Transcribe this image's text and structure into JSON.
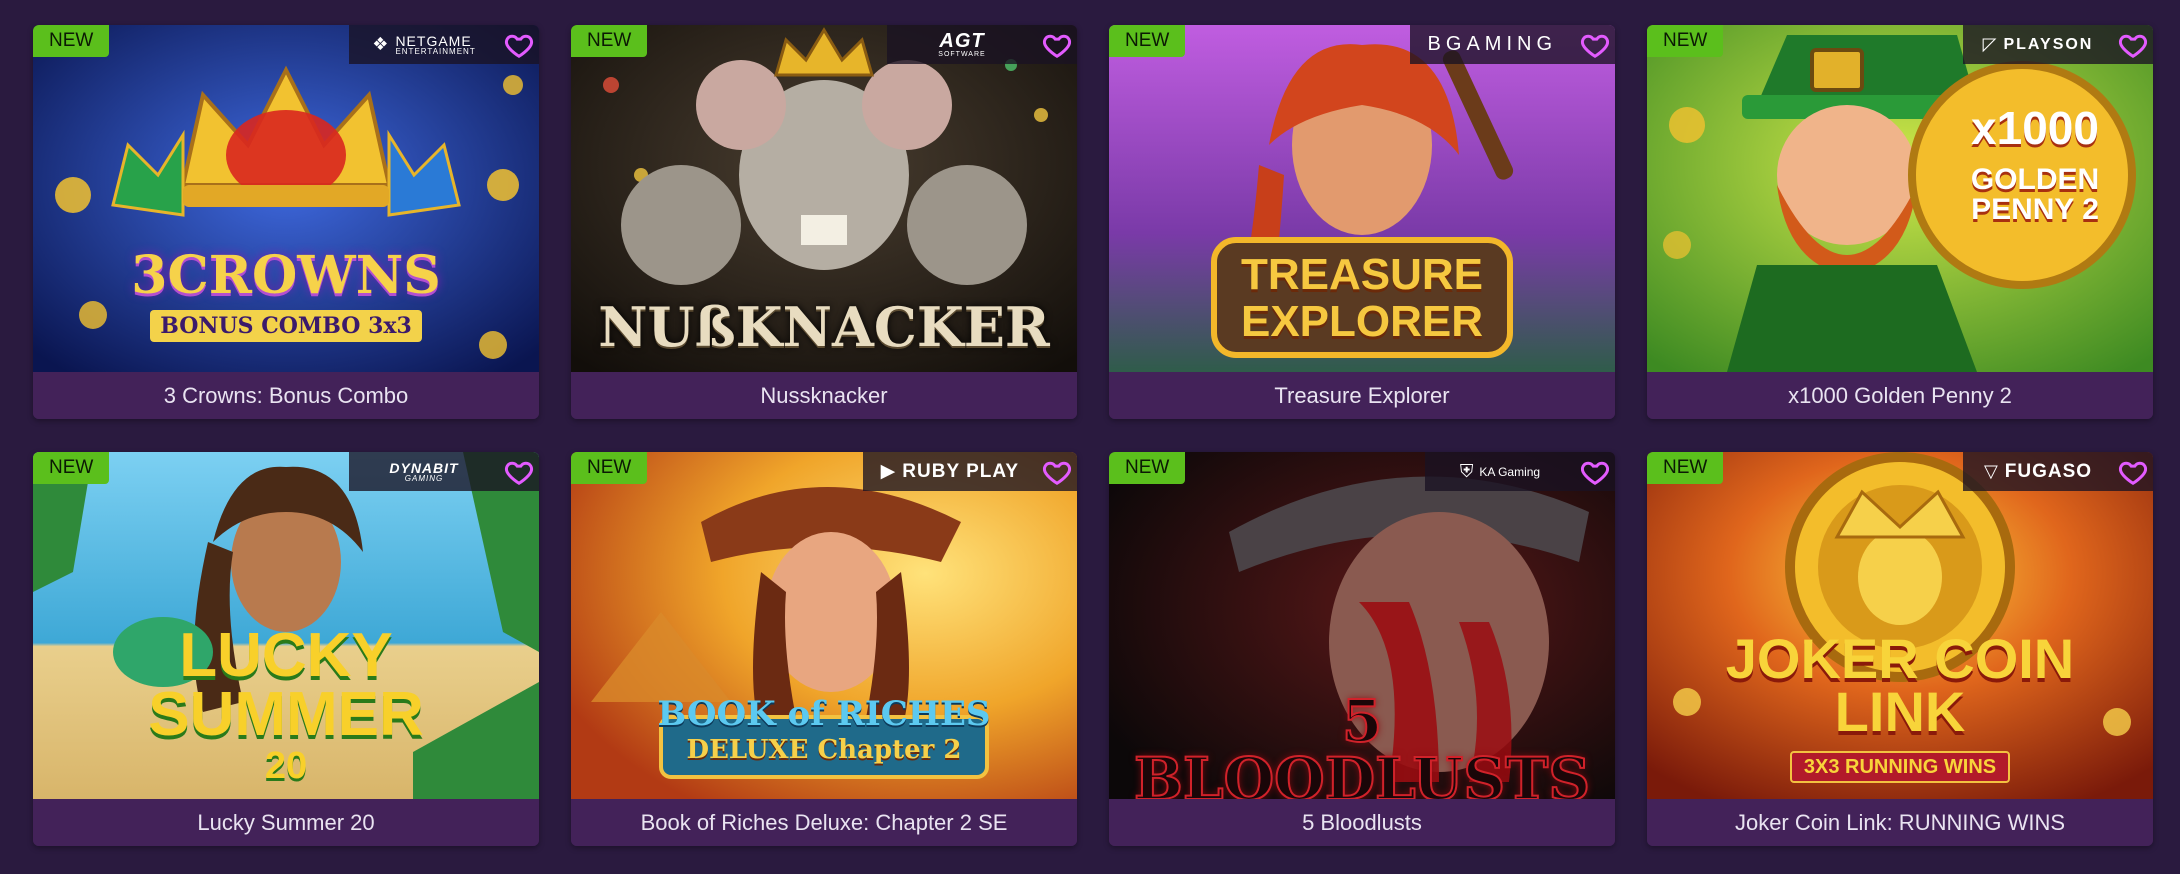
{
  "games": [
    {
      "title": "3 Crowns: Bonus Combo",
      "badge": "NEW",
      "provider": "NETGAME",
      "provider_sub": "ENTERTAINMENT",
      "logo_main": "3CROWNS",
      "logo_sub": "BONUS COMBO 3x3",
      "colors": [
        "#1b3c9c",
        "#0a1550",
        "#f2c230"
      ]
    },
    {
      "title": "Nussknacker",
      "badge": "NEW",
      "provider": "AGT",
      "provider_sub": "SOFTWARE",
      "logo_main": "NUßKNACKER",
      "logo_sub": "",
      "colors": [
        "#3a3228",
        "#15110c",
        "#d8c9a8"
      ]
    },
    {
      "title": "Treasure Explorer",
      "badge": "NEW",
      "provider": "BGAMING",
      "provider_sub": "",
      "logo_main": "TREASURE",
      "logo_sub": "EXPLORER",
      "colors": [
        "#b24ad4",
        "#2f5c4a",
        "#f3b72a"
      ]
    },
    {
      "title": "x1000 Golden Penny 2",
      "badge": "NEW",
      "provider": "PLAYSON",
      "provider_sub": "",
      "logo_main": "x1000",
      "logo_sub": "GOLDEN PENNY 2",
      "colors": [
        "#8fc42a",
        "#1d6b20",
        "#e33a2b"
      ]
    },
    {
      "title": "Lucky Summer 20",
      "badge": "NEW",
      "provider": "DYNABIT",
      "provider_sub": "GAMING",
      "logo_main": "LUCKY SUMMER",
      "logo_sub": "20",
      "colors": [
        "#56b7e4",
        "#e9cf8c",
        "#f6c51e"
      ]
    },
    {
      "title": "Book of Riches Deluxe: Chapter 2 SE",
      "badge": "NEW",
      "provider": "RUBY PLAY",
      "provider_sub": "",
      "logo_main": "BOOK of RICHES",
      "logo_sub": "DELUXE Chapter 2",
      "colors": [
        "#f0a52a",
        "#c2491a",
        "#41b9e6"
      ]
    },
    {
      "title": "5 Bloodlusts",
      "badge": "NEW",
      "provider": "KA Gaming",
      "provider_sub": "",
      "logo_main": "5 BLOODLUSTS",
      "logo_sub": "",
      "colors": [
        "#1a1214",
        "#5b1010",
        "#c8232a"
      ]
    },
    {
      "title": "Joker Coin Link: RUNNING WINS",
      "badge": "NEW",
      "provider": "FUGASO",
      "provider_sub": "",
      "logo_main": "JOKER COIN LINK",
      "logo_sub": "3X3 RUNNING WINS",
      "colors": [
        "#d9591b",
        "#8a1d0d",
        "#f6d136"
      ]
    }
  ],
  "favorite_icon": "heart-icon",
  "favorite_color": "#e35bff",
  "badge_color": "#5bbf1c"
}
